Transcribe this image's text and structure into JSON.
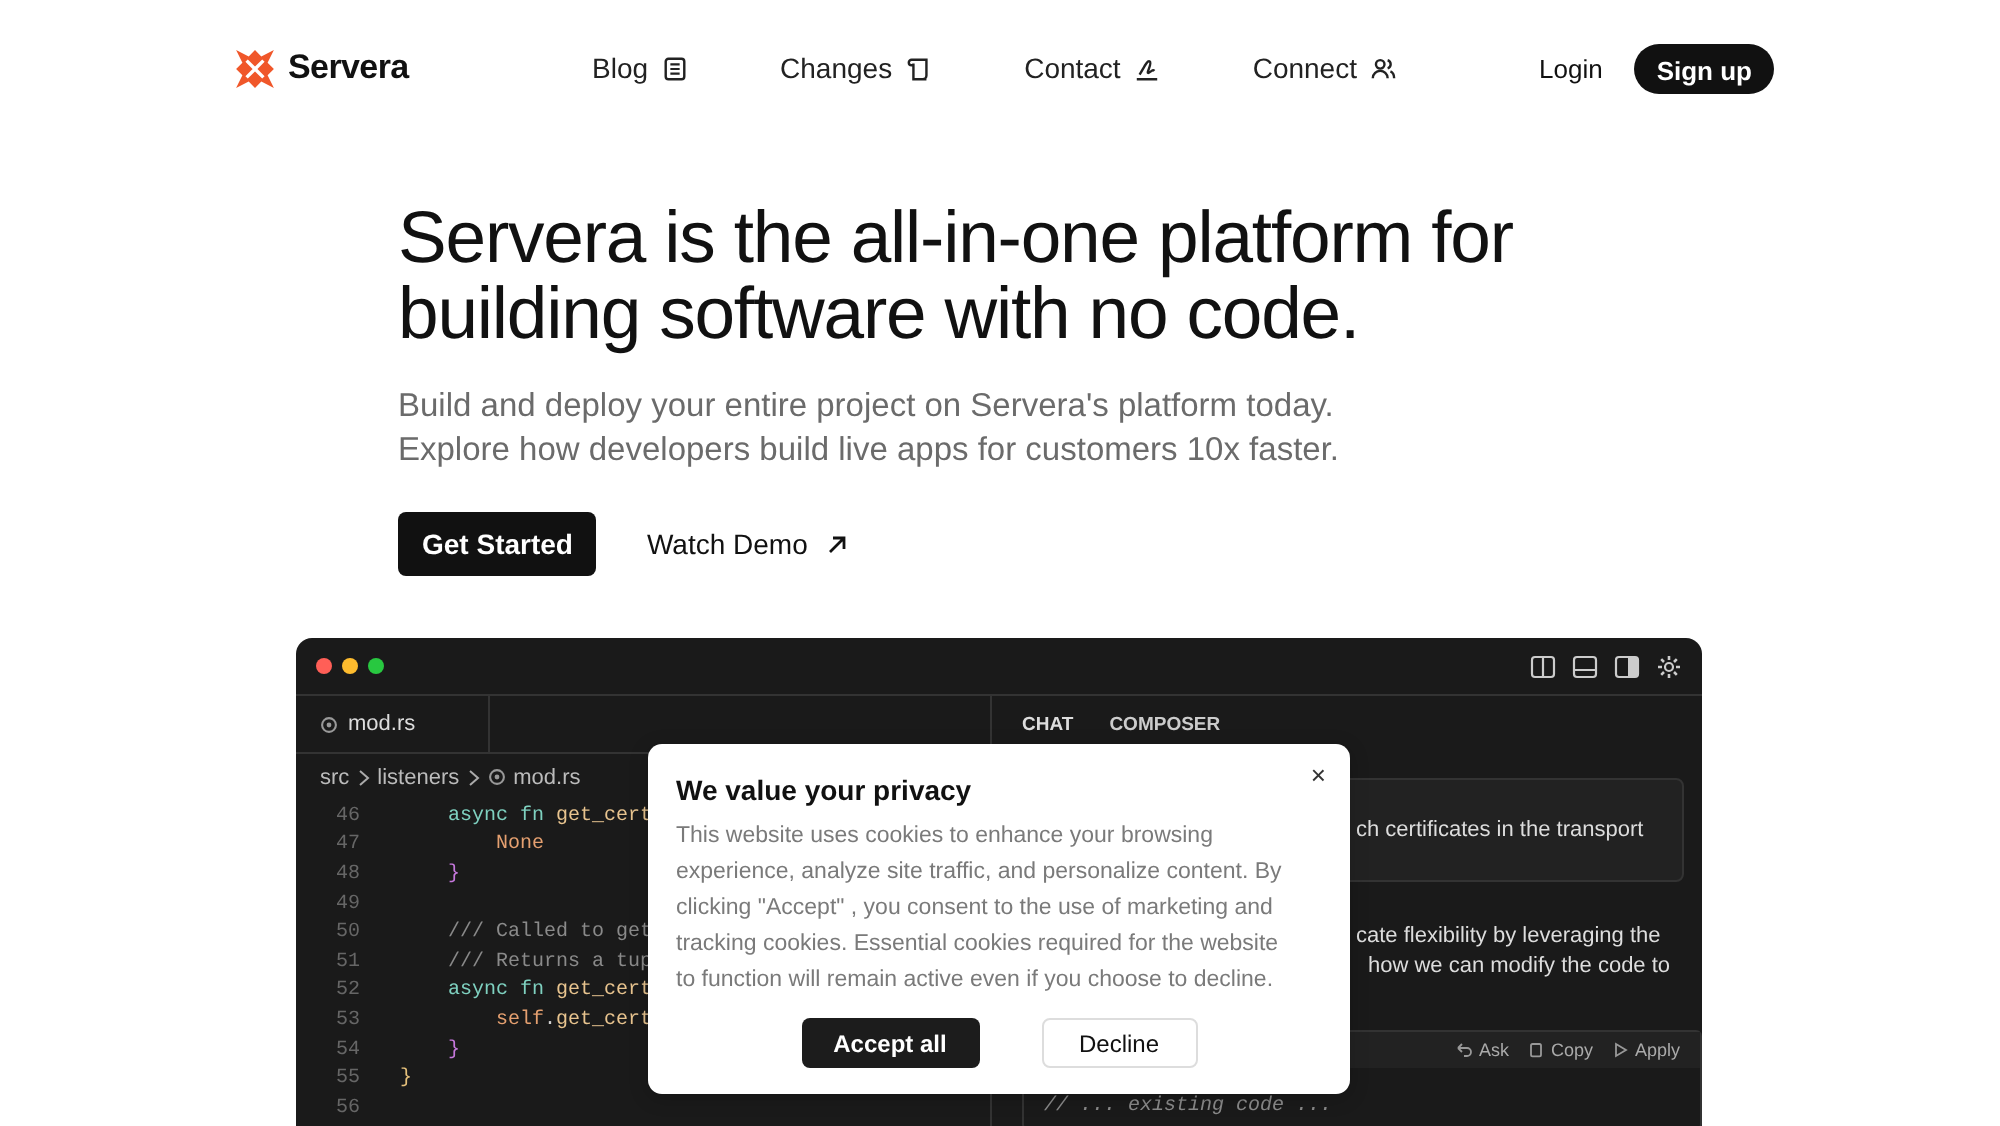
{
  "nav": {
    "brand": "Servera",
    "links": [
      {
        "label": "Blog",
        "kind": "blog"
      },
      {
        "label": "Changes",
        "kind": "changes"
      },
      {
        "label": "Contact",
        "kind": "contact"
      },
      {
        "label": "Connect",
        "kind": "connect"
      }
    ],
    "login": "Login",
    "signup": "Sign up"
  },
  "hero": {
    "title": "Servera is the all-in-one platform for building software with no code.",
    "subtitle_lines": [
      "Build and deploy your entire project on Servera's platform today.",
      "Explore how developers build live apps for customers 10x faster."
    ],
    "primary_button": "Get Started",
    "secondary_button": "Watch Demo"
  },
  "editor": {
    "file_tab": "mod.rs",
    "breadcrumb": [
      "src",
      "listeners",
      "mod.rs"
    ],
    "code_lines": [
      {
        "number": "46",
        "tokens": [
          {
            "kind": "keyword",
            "text": "    async fn "
          },
          {
            "kind": "function",
            "text": "get_cert"
          }
        ]
      },
      {
        "number": "47",
        "tokens": [
          {
            "kind": "constant",
            "text": "        None"
          }
        ]
      },
      {
        "number": "48",
        "tokens": [
          {
            "kind": "brace",
            "text": "    }"
          }
        ]
      },
      {
        "number": "49"
      },
      {
        "number": "50",
        "tokens": [
          {
            "kind": "comment",
            "text": "    /// Called to get"
          }
        ]
      },
      {
        "number": "51",
        "tokens": [
          {
            "kind": "comment",
            "text": "    /// Returns a tup"
          }
        ]
      },
      {
        "number": "52",
        "tokens": [
          {
            "kind": "keyword",
            "text": "    async fn "
          },
          {
            "kind": "function",
            "text": "get_cert"
          }
        ]
      },
      {
        "number": "53",
        "tokens": [
          {
            "kind": "constant",
            "text": "        self"
          },
          {
            "kind": "plain",
            "text": "."
          },
          {
            "kind": "function",
            "text": "get_cert"
          }
        ]
      },
      {
        "number": "54",
        "tokens": [
          {
            "kind": "brace",
            "text": "    }"
          }
        ]
      },
      {
        "number": "55",
        "tokens": [
          {
            "kind": "outer",
            "text": "}"
          }
        ]
      },
      {
        "number": "56"
      }
    ],
    "panel_tabs": [
      {
        "label": "CHAT",
        "selected": true
      },
      {
        "label": "COMPOSER",
        "selected": false
      }
    ],
    "message": "ch certificates in the transport",
    "reply_lines": [
      "cate flexibility by leveraging the",
      "how we can modify the code to"
    ],
    "code_actions": [
      "Ask",
      "Copy",
      "Apply"
    ],
    "block_code": "// ... existing code ..."
  },
  "cookie_dialog": {
    "title": "We value your privacy",
    "close": "×",
    "body": "This website uses cookies to enhance your browsing experience, analyze site traffic, and personalize content. By clicking \"Accept\" , you consent to the use of marketing and tracking cookies. Essential cookies required for the website to function will remain active even if you choose to decline.",
    "accept": "Accept all",
    "decline": "Decline"
  }
}
